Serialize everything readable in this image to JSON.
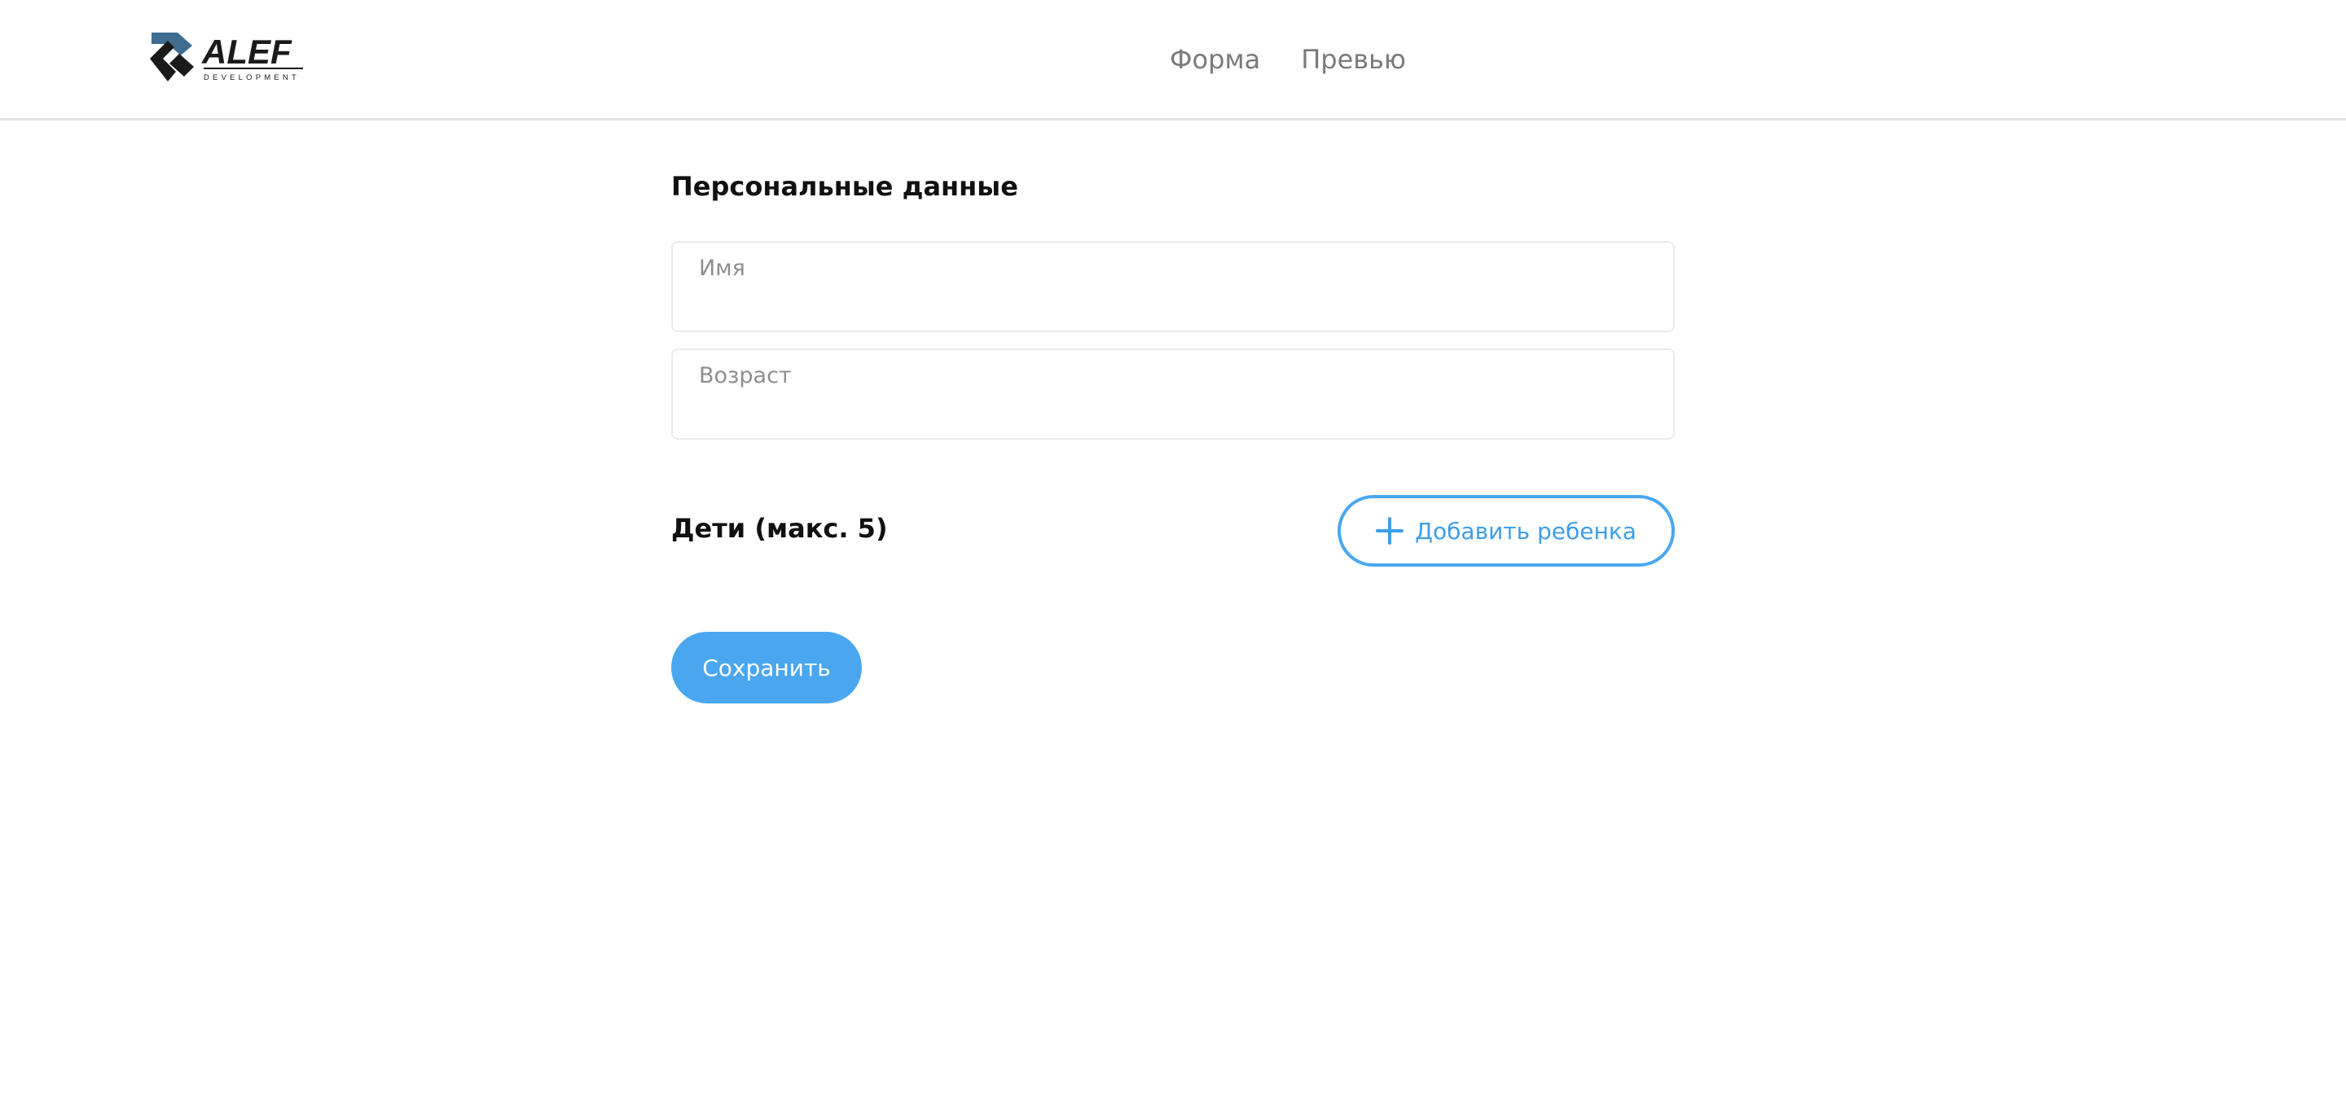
{
  "brand": {
    "logo_text": "ALEF",
    "logo_subtext": "DEVELOPMENT"
  },
  "nav": {
    "items": [
      {
        "label": "Форма"
      },
      {
        "label": "Превью"
      }
    ]
  },
  "form": {
    "section_title": "Персональные данные",
    "name_field": {
      "label": "Имя",
      "value": ""
    },
    "age_field": {
      "label": "Возраст",
      "value": ""
    },
    "children_title": "Дети (макс. 5)",
    "add_child_label": "Добавить ребенка",
    "save_label": "Сохранить"
  },
  "colors": {
    "accent": "#4aa7ef",
    "logo_dark": "#1a1a1a",
    "logo_blue": "#3f6d92"
  }
}
